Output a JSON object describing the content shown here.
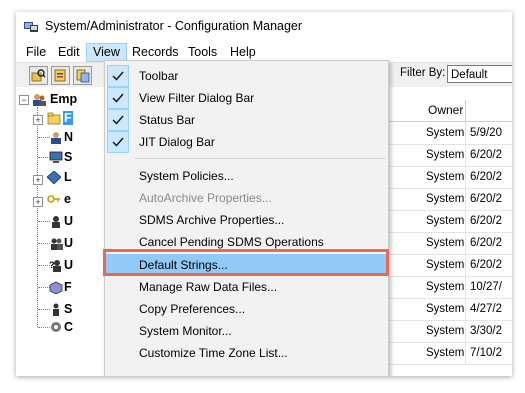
{
  "window": {
    "title": "System/Administrator - Configuration Manager"
  },
  "menubar": {
    "items": [
      "File",
      "Edit",
      "View",
      "Records",
      "Tools",
      "Help"
    ]
  },
  "toolbar": {
    "filter_label": "Filter By:",
    "filter_value": "Default"
  },
  "tree": {
    "root_label": "Emp",
    "items": [
      {
        "icon": "folder-icon",
        "label": "F"
      },
      {
        "icon": "user-icon",
        "label": "N"
      },
      {
        "icon": "computer-icon",
        "label": "S"
      },
      {
        "icon": "diamond-icon",
        "label": "L"
      },
      {
        "icon": "key-icon",
        "label": "e"
      },
      {
        "icon": "user-icon",
        "label": "U"
      },
      {
        "icon": "users-icon",
        "label": "U"
      },
      {
        "icon": "unknown-user-icon",
        "label": "U"
      },
      {
        "icon": "cube-icon",
        "label": "F"
      },
      {
        "icon": "person-icon",
        "label": "S"
      },
      {
        "icon": "gear-person-icon",
        "label": "C"
      }
    ]
  },
  "grid": {
    "header_owner": "Owner",
    "rows": [
      {
        "owner": "System",
        "date": "5/9/20"
      },
      {
        "owner": "System",
        "date": "6/20/2"
      },
      {
        "owner": "System",
        "date": "6/20/2"
      },
      {
        "owner": "System",
        "date": "6/20/2"
      },
      {
        "owner": "System",
        "date": "6/20/2"
      },
      {
        "owner": "System",
        "date": "6/20/2"
      },
      {
        "owner": "System",
        "date": "6/20/2"
      },
      {
        "owner": "System",
        "date": "10/27/"
      },
      {
        "owner": "System",
        "date": "4/27/2"
      },
      {
        "owner": "System",
        "date": "3/30/2"
      },
      {
        "owner": "System",
        "date": "7/10/2"
      }
    ],
    "fragment_s": "s",
    "fragment_st": "st"
  },
  "view_menu": {
    "checked_items": [
      {
        "label": "Toolbar",
        "checked": true
      },
      {
        "label": "View Filter Dialog Bar",
        "checked": true
      },
      {
        "label": "Status Bar",
        "checked": true
      },
      {
        "label": "JIT Dialog Bar",
        "checked": true
      }
    ],
    "items": [
      {
        "label": "System Policies...",
        "enabled": true
      },
      {
        "label": "AutoArchive Properties...",
        "enabled": false
      },
      {
        "label": "SDMS Archive Properties...",
        "enabled": true
      },
      {
        "label": "Cancel Pending SDMS Operations",
        "enabled": true
      },
      {
        "label": "Default Strings...",
        "enabled": true,
        "highlighted": true
      },
      {
        "label": "Manage Raw Data Files...",
        "enabled": true
      },
      {
        "label": "Copy Preferences...",
        "enabled": true
      },
      {
        "label": "System Monitor...",
        "enabled": true
      },
      {
        "label": "Customize Time Zone List...",
        "enabled": true
      }
    ]
  },
  "colors": {
    "highlight_border": "#e86a55",
    "menu_highlight": "#91c9f7",
    "check_bg": "#cce8ff"
  }
}
